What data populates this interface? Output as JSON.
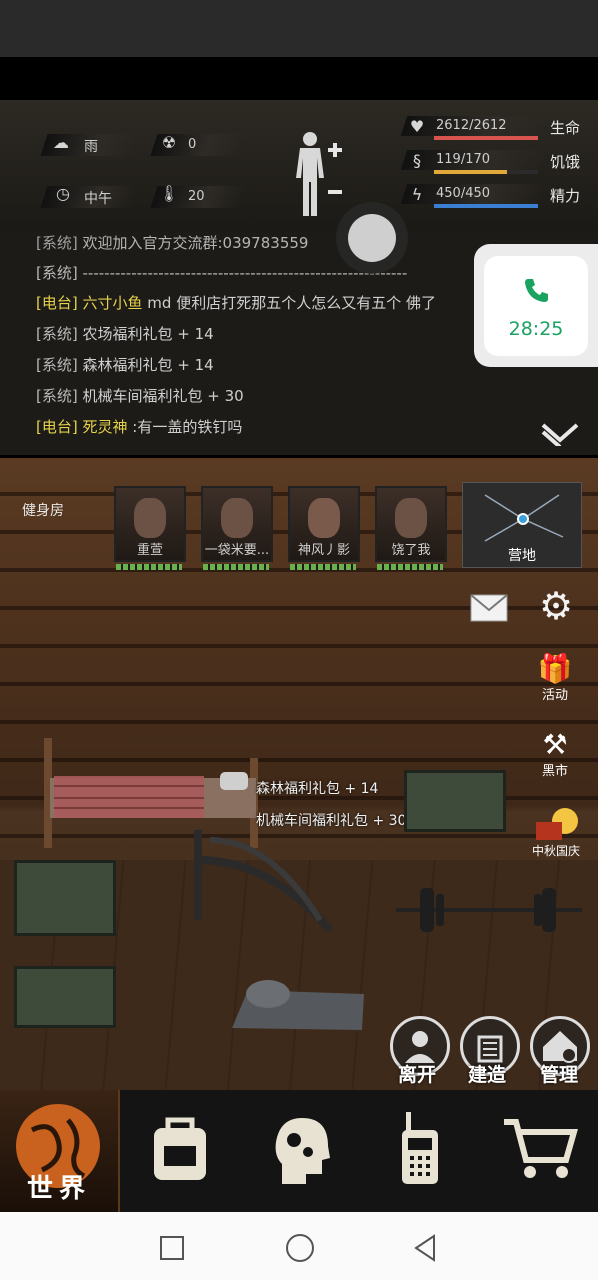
{
  "stats": {
    "weather": "雨",
    "radiation": "0",
    "time_of_day": "中午",
    "temperature": "20",
    "health": {
      "value": "2612/2612",
      "label": "生命",
      "fraction": 1.0,
      "color": "#d9534f"
    },
    "hunger": {
      "value": "119/170",
      "label": "饥饿",
      "fraction": 0.7,
      "color": "#e0a93a"
    },
    "energy": {
      "value": "450/450",
      "label": "精力",
      "fraction": 1.0,
      "color": "#3a7fd1"
    }
  },
  "chat": {
    "lines": [
      {
        "tag": "[系统]",
        "text": "欢迎加入官方交流群:039783559",
        "type": "system"
      },
      {
        "tag": "[系统]",
        "text": "------------------------------------------------------------",
        "type": "system"
      },
      {
        "tag": "[电台]",
        "name": "六寸小鱼",
        "text": "md 便利店打死那五个人怎么又有五个 佛了",
        "type": "radio"
      },
      {
        "tag": "[系统]",
        "text": "农场福利礼包 + 14",
        "type": "system"
      },
      {
        "tag": "[系统]",
        "text": "森林福利礼包 + 14",
        "type": "system"
      },
      {
        "tag": "[系统]",
        "text": "机械车间福利礼包 + 30",
        "type": "system"
      },
      {
        "tag": "[电台]",
        "name": "死灵神",
        "text": ":有一盖的铁钉吗",
        "type": "radio"
      }
    ]
  },
  "timer": {
    "time": "28:25",
    "accent": "#1aa260"
  },
  "room": {
    "name": "健身房",
    "companions": [
      {
        "name": "重萱"
      },
      {
        "name": "一袋米要..."
      },
      {
        "name": "神风丿影"
      },
      {
        "name": "饶了我"
      }
    ],
    "map_label": "营地",
    "notifications": [
      "森林福利礼包 + 14",
      "机械车间福利礼包 + 30"
    ],
    "side_buttons": {
      "event": "活动",
      "black_market": "黑市",
      "festival": "中秋国庆"
    },
    "actions": {
      "leave": "离开",
      "build": "建造",
      "manage": "管理"
    }
  },
  "nav": {
    "world": "世界"
  }
}
